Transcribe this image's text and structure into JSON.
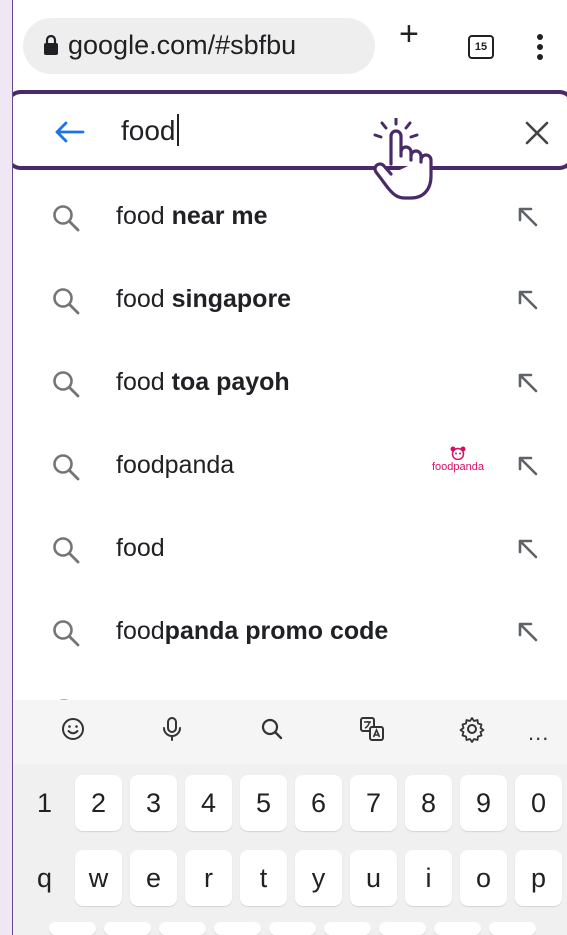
{
  "browser": {
    "url": "google.com/#sbfbu",
    "new_tab_label": "+",
    "tab_count": "15"
  },
  "search": {
    "query": "food"
  },
  "suggestions": [
    {
      "prefix": "food",
      "bold": " near me",
      "logo": ""
    },
    {
      "prefix": "food",
      "bold": " singapore",
      "logo": ""
    },
    {
      "prefix": "food",
      "bold": " toa payoh",
      "logo": ""
    },
    {
      "prefix": "foodpanda",
      "bold": "",
      "logo": "foodpanda"
    },
    {
      "prefix": "food",
      "bold": "",
      "logo": ""
    },
    {
      "prefix": "food",
      "bold": "panda promo code",
      "logo": ""
    }
  ],
  "keyboard": {
    "toolbar_more": "...",
    "number_row": [
      "1",
      "2",
      "3",
      "4",
      "5",
      "6",
      "7",
      "8",
      "9",
      "0"
    ],
    "letter_row": [
      "q",
      "w",
      "e",
      "r",
      "t",
      "y",
      "u",
      "i",
      "o",
      "p"
    ]
  },
  "colors": {
    "highlight_border": "#4a2a66",
    "back_arrow": "#1a73e8",
    "foodpanda_pink": "#d70f64"
  }
}
